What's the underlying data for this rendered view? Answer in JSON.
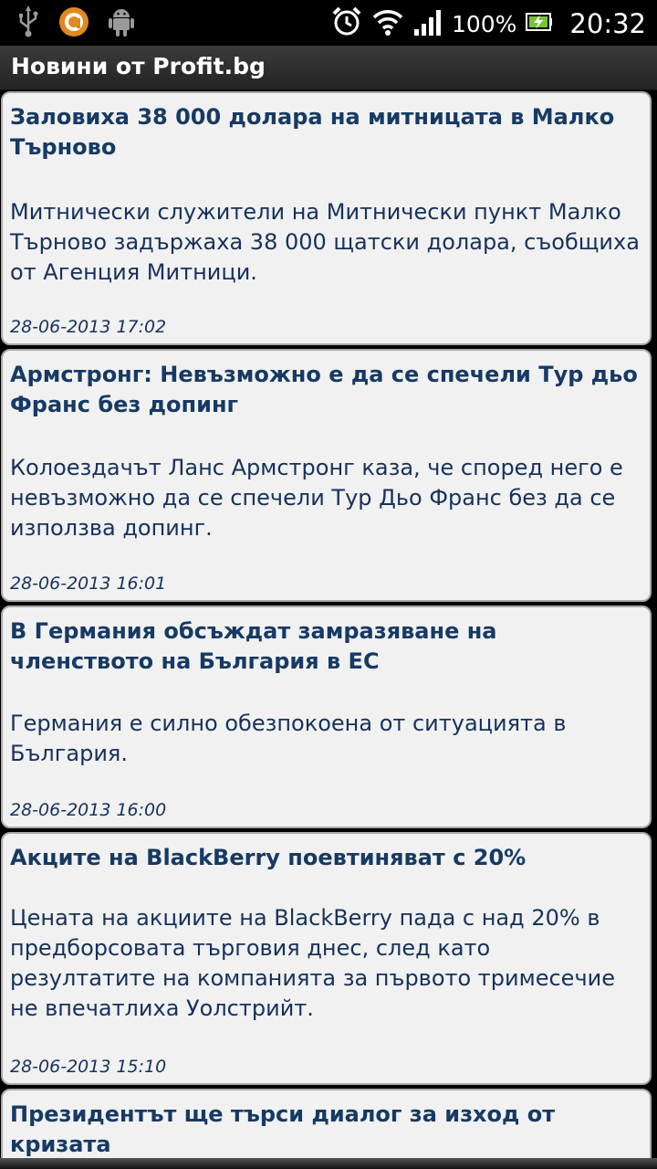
{
  "statusbar": {
    "battery": "100%",
    "time": "20:32",
    "icons": [
      "usb-icon",
      "app-notification-icon",
      "android-icon",
      "alarm-icon",
      "wifi-icon",
      "signal-icon",
      "battery-charging-icon"
    ]
  },
  "app": {
    "title": "Новини от Profit.bg"
  },
  "news": [
    {
      "title": "Заловиха 38 000 долара на митницата в Малко Търново",
      "summary": "Митнически служители на Митнически пункт Малко Търново задържаха 38 000 щатски долара, съобщиха от Агенция Митници.",
      "date": "28-06-2013 17:02"
    },
    {
      "title": "Армстронг: Невъзможно е да се спечели Тур дьо Франс без допинг",
      "summary": "Колоездачът Ланс Армстронг каза, че според него е невъзможно да се спечели Тур Дьо Франс без да се използва допинг.",
      "date": "28-06-2013 16:01"
    },
    {
      "title": "В Германия обсъждат замразяване на членството на България в ЕС",
      "summary": "Германия е силно обезпокоена от ситуацията в България.",
      "date": "28-06-2013 16:00"
    },
    {
      "title": "Акците на BlackBerry поевтиняват с 20%",
      "summary": "Цената на акциите на BlackBerry пада с над 20% в предборсовата търговия днес, след като резултатите на компанията за първото тримесечие не впечатлиха Уолстрийт.",
      "date": "28-06-2013 15:10"
    },
    {
      "title": "Президентът ще търси диалог за изход от кризата"
    }
  ]
}
